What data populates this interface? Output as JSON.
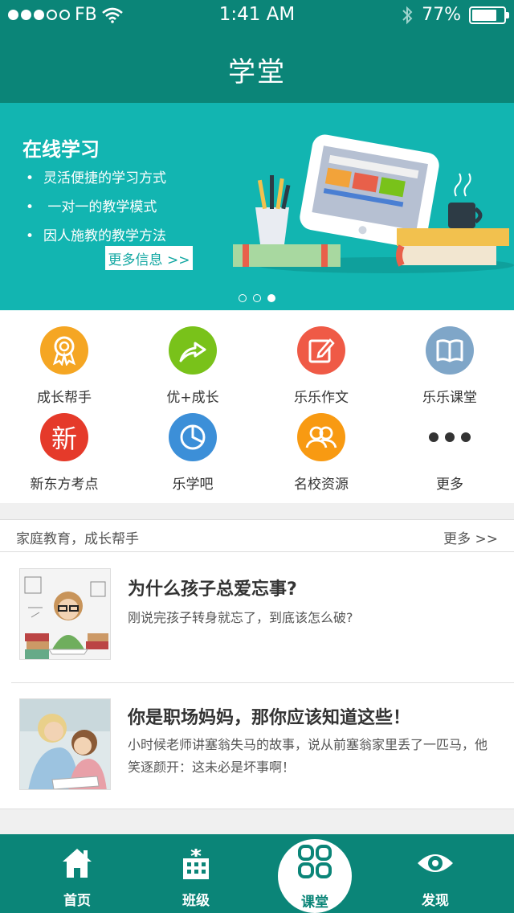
{
  "status_bar": {
    "carrier": "FB",
    "time": "1:41 AM",
    "battery": "77%"
  },
  "nav": {
    "title": "学堂"
  },
  "banner": {
    "heading": "在线学习",
    "bullets": [
      "灵活便捷的学习方式",
      " 一对一的教学模式",
      "因人施教的教学方法"
    ],
    "more_button": "更多信息 >>",
    "page_count": 3,
    "active_page": 3
  },
  "grid": [
    {
      "label": "成长帮手",
      "icon": "award-ribbon-icon",
      "color": "#f5a623"
    },
    {
      "label": "优+成长",
      "icon": "growth-arrow-icon",
      "color": "#79c21a"
    },
    {
      "label": "乐乐作文",
      "icon": "edit-pencil-icon",
      "color": "#ef5a46"
    },
    {
      "label": "乐乐课堂",
      "icon": "open-book-icon",
      "color": "#7fa6c8"
    },
    {
      "label": "新东方考点",
      "icon": "xin-character-icon",
      "glyph": "新",
      "color": "#e53a2a"
    },
    {
      "label": "乐学吧",
      "icon": "pie-chart-icon",
      "color": "#3c8fd8"
    },
    {
      "label": "名校资源",
      "icon": "people-icon",
      "color": "#f89a12"
    },
    {
      "label": "更多",
      "icon": "more-dots-icon",
      "color": "#333333"
    }
  ],
  "section": {
    "title": "家庭教育，成长帮手",
    "more": "更多 >>"
  },
  "articles": [
    {
      "title": "为什么孩子总爱忘事?",
      "desc": "刚说完孩子转身就忘了，到底该怎么破?"
    },
    {
      "title": "你是职场妈妈，那你应该知道这些！",
      "desc": "小时候老师讲塞翁失马的故事，说从前塞翁家里丢了一匹马，他笑逐颜开：这未必是坏事啊！"
    }
  ],
  "tabs": [
    {
      "label": "首页",
      "icon": "home-icon"
    },
    {
      "label": "班级",
      "icon": "class-building-icon"
    },
    {
      "label": "课堂",
      "icon": "grid-apps-icon",
      "active": true
    },
    {
      "label": "发现",
      "icon": "eye-icon"
    }
  ],
  "colors": {
    "primary": "#0b8578",
    "banner": "#12b5b1"
  }
}
